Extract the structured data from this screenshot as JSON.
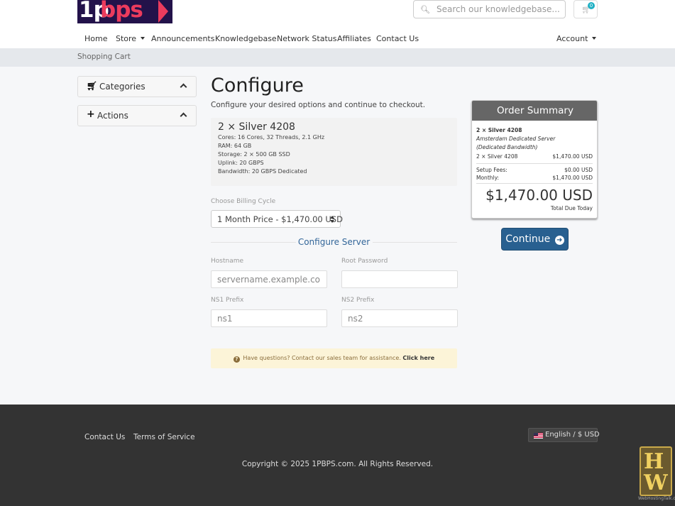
{
  "brand": {
    "logo_text_num": "1p",
    "logo_text": "bps",
    "logo_color_bg": "#23124a",
    "logo_color_accent": "#ec3b5d"
  },
  "header": {
    "search_placeholder": "Search our knowledgebase...",
    "cart_count": "0"
  },
  "nav": {
    "items": [
      "Home",
      "Store",
      "Announcements",
      "Knowledgebase",
      "Network Status",
      "Affiliates",
      "Contact Us"
    ],
    "account": "Account"
  },
  "breadcrumb": "Shopping Cart",
  "sidebar": {
    "categories": "Categories",
    "actions": "Actions"
  },
  "page": {
    "title": "Configure",
    "subtitle": "Configure your desired options and continue to checkout."
  },
  "product": {
    "name": "2 × Silver 4208",
    "specs": [
      "Cores: 16 Cores, 32 Threads, 2.1 GHz",
      "RAM: 64 GB",
      "Storage: 2 × 500 GB SSD",
      "Uplink: 20 GBPS",
      "Bandwidth: 20 GBPS Dedicated"
    ]
  },
  "billing": {
    "label": "Choose Billing Cycle",
    "selected": "1 Month Price - $1,470.00 USD"
  },
  "configure_server": {
    "heading": "Configure Server",
    "hostname_label": "Hostname",
    "hostname_placeholder": "servername.example.com",
    "root_password_label": "Root Password",
    "ns1_label": "NS1 Prefix",
    "ns1_placeholder": "ns1",
    "ns2_label": "NS2 Prefix",
    "ns2_placeholder": "ns2"
  },
  "info": {
    "text": "Have questions? Contact our sales team for assistance.",
    "link": "Click here"
  },
  "summary": {
    "heading": "Order Summary",
    "product_name": "2 × Silver 4208",
    "product_group": "Amsterdam Dedicated Server (Dedicated Bandwidth)",
    "line_item": "2 × Silver 4208",
    "line_price": "$1,470.00 USD",
    "setup_label": "Setup Fees:",
    "setup_value": "$0.00 USD",
    "monthly_label": "Monthly:",
    "monthly_value": "$1,470.00 USD",
    "total": "$1,470.00 USD",
    "total_label": "Total Due Today"
  },
  "continue_label": "Continue",
  "footer": {
    "links": [
      "Contact Us",
      "Terms of Service"
    ],
    "language": "English / $ USD",
    "copyright": "Copyright © 2025 1PBPS.com. All Rights Reserved."
  },
  "watermark": {
    "caption": "WebHostingTalk.com"
  },
  "colors": {
    "primary": "#286090",
    "footer_bg": "#333333",
    "summary_header": "#666666",
    "info_bg": "#fcf4d8"
  }
}
